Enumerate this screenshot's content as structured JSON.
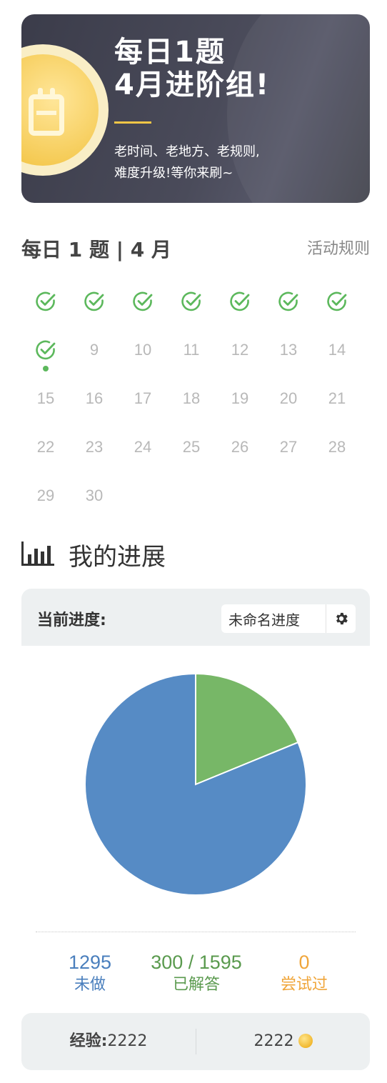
{
  "banner": {
    "title_line1": "每日1题",
    "title_line2": "4月进阶组!",
    "sub_line1": "老时间、老地方、老规则,",
    "sub_line2": "难度升级!等你来刷~"
  },
  "calendar": {
    "title": "每日 1 题 | 4 月",
    "rules_link": "活动规则",
    "days": [
      {
        "day": "1",
        "done": true
      },
      {
        "day": "2",
        "done": true
      },
      {
        "day": "3",
        "done": true
      },
      {
        "day": "4",
        "done": true
      },
      {
        "day": "5",
        "done": true
      },
      {
        "day": "6",
        "done": true
      },
      {
        "day": "7",
        "done": true
      },
      {
        "day": "8",
        "done": true,
        "today": true
      },
      {
        "day": "9",
        "done": false
      },
      {
        "day": "10",
        "done": false
      },
      {
        "day": "11",
        "done": false
      },
      {
        "day": "12",
        "done": false
      },
      {
        "day": "13",
        "done": false
      },
      {
        "day": "14",
        "done": false
      },
      {
        "day": "15",
        "done": false
      },
      {
        "day": "16",
        "done": false
      },
      {
        "day": "17",
        "done": false
      },
      {
        "day": "18",
        "done": false
      },
      {
        "day": "19",
        "done": false
      },
      {
        "day": "20",
        "done": false
      },
      {
        "day": "21",
        "done": false
      },
      {
        "day": "22",
        "done": false
      },
      {
        "day": "23",
        "done": false
      },
      {
        "day": "24",
        "done": false
      },
      {
        "day": "25",
        "done": false
      },
      {
        "day": "26",
        "done": false
      },
      {
        "day": "27",
        "done": false
      },
      {
        "day": "28",
        "done": false
      },
      {
        "day": "29",
        "done": false
      },
      {
        "day": "30",
        "done": false
      }
    ],
    "check_color": "#5cb85c"
  },
  "progress": {
    "heading": "我的进展",
    "current_label": "当前进度:",
    "session_name": "未命名进度",
    "settings_icon": "gear-icon"
  },
  "chart_data": {
    "type": "pie",
    "slices": [
      {
        "label": "已解答",
        "value": 300,
        "color": "#77b767"
      },
      {
        "label": "未做",
        "value": 1295,
        "color": "#568bc5"
      }
    ]
  },
  "stats": {
    "todo_value": "1295",
    "todo_label": "未做",
    "solved_value": "300 / 1595",
    "solved_label": "已解答",
    "attempted_value": "0",
    "attempted_label": "尝试过",
    "colors": {
      "todo": "#4a7fbd",
      "solved": "#5a9a4e",
      "attempted": "#f0a63b"
    }
  },
  "footer": {
    "exp_label": "经验:",
    "exp_value": "2222",
    "coins_value": "2222"
  }
}
